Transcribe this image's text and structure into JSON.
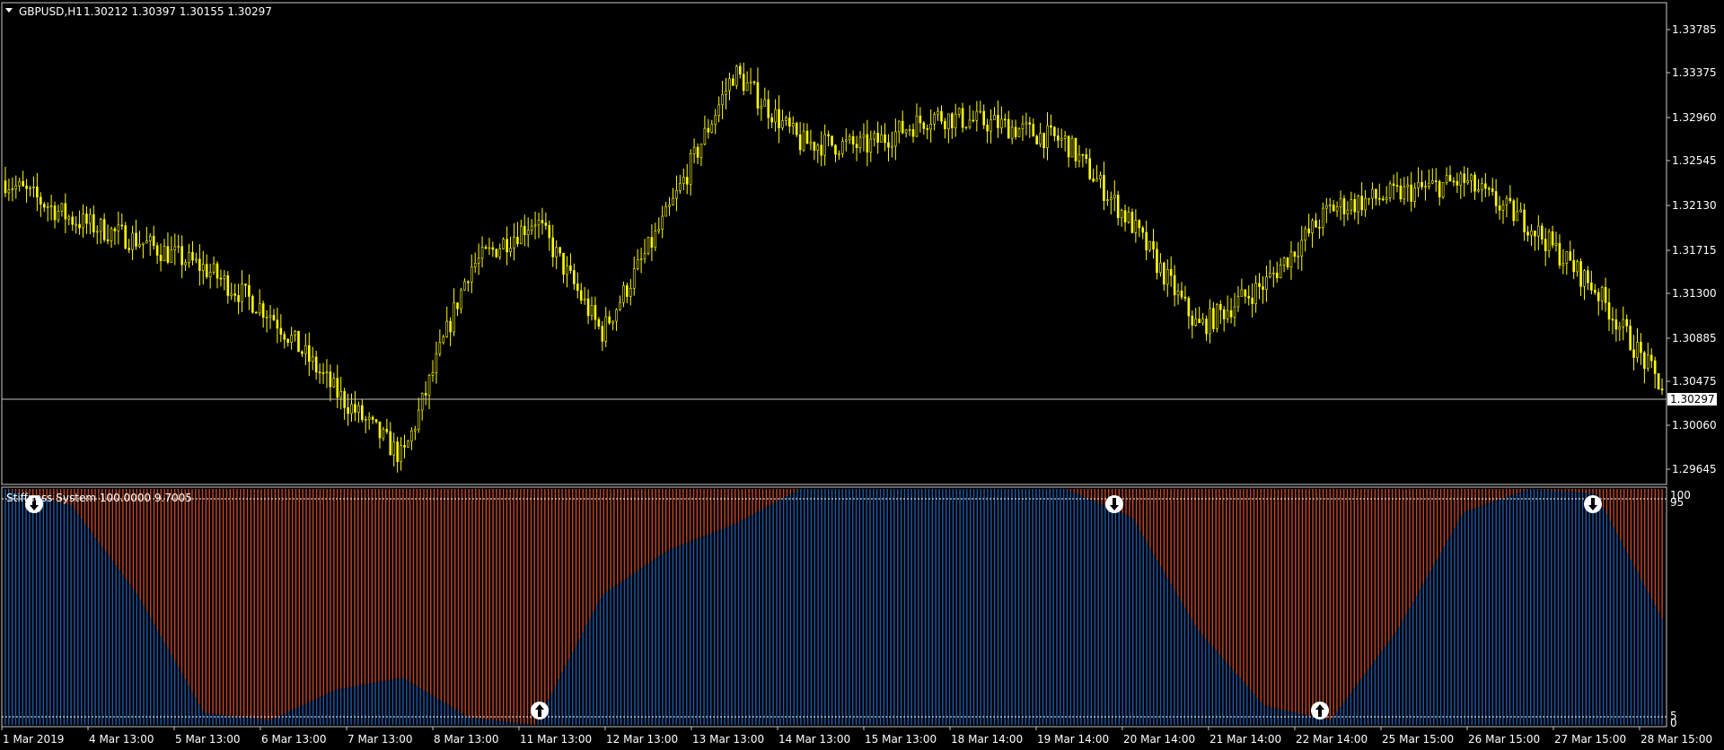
{
  "main_chart": {
    "symbol_label": "GBPUSD,H1",
    "ohlc": "1.30212 1.30397 1.30155 1.30297",
    "current_price": "1.30297",
    "price_ticks": [
      "1.33785",
      "1.33375",
      "1.32960",
      "1.32545",
      "1.32130",
      "1.31715",
      "1.31300",
      "1.30885",
      "1.30475",
      "1.30060",
      "1.29645"
    ],
    "candle_color": "#ffff00"
  },
  "indicator": {
    "title": "Stiffness System 100.0000 9.7005",
    "level_ticks": [
      "100",
      "95",
      "5",
      "0"
    ],
    "bull_color": "#1f5aa8",
    "bear_color": "#c4482a"
  },
  "time_axis": {
    "labels": [
      "1 Mar 2019",
      "4 Mar 13:00",
      "5 Mar 13:00",
      "6 Mar 13:00",
      "7 Mar 13:00",
      "8 Mar 13:00",
      "11 Mar 13:00",
      "12 Mar 13:00",
      "13 Mar 13:00",
      "14 Mar 13:00",
      "15 Mar 13:00",
      "18 Mar 14:00",
      "19 Mar 14:00",
      "20 Mar 14:00",
      "21 Mar 14:00",
      "22 Mar 14:00",
      "25 Mar 15:00",
      "26 Mar 15:00",
      "27 Mar 15:00",
      "28 Mar 15:00"
    ]
  },
  "chart_data": {
    "type": "line",
    "title": "GBPUSD,H1",
    "xlabel": "",
    "ylabel": "",
    "ylim": [
      1.2955,
      1.3388
    ],
    "x": [
      "1 Mar 2019",
      "4 Mar 13:00",
      "5 Mar 13:00",
      "6 Mar 13:00",
      "7 Mar 13:00",
      "8 Mar 13:00",
      "11 Mar 13:00",
      "12 Mar 13:00",
      "13 Mar 13:00",
      "14 Mar 13:00",
      "15 Mar 13:00",
      "18 Mar 14:00",
      "19 Mar 14:00",
      "20 Mar 14:00",
      "21 Mar 14:00",
      "22 Mar 14:00",
      "25 Mar 15:00",
      "26 Mar 15:00",
      "27 Mar 15:00",
      "28 Mar 15:00"
    ],
    "price_path": [
      1.323,
      1.3195,
      1.3175,
      1.315,
      1.3108,
      1.3035,
      1.2975,
      1.315,
      1.3195,
      1.309,
      1.32,
      1.333,
      1.3265,
      1.3262,
      1.329,
      1.3282,
      1.3266,
      1.319,
      1.3095,
      1.3135,
      1.3205,
      1.3218,
      1.323,
      1.319,
      1.313,
      1.304
    ],
    "stiffness_path": [
      100,
      93,
      55,
      5,
      2,
      15,
      20,
      3,
      0,
      55,
      74,
      85,
      100,
      100,
      100,
      100,
      100,
      88,
      40,
      8,
      2,
      40,
      90,
      100,
      98,
      45
    ]
  }
}
